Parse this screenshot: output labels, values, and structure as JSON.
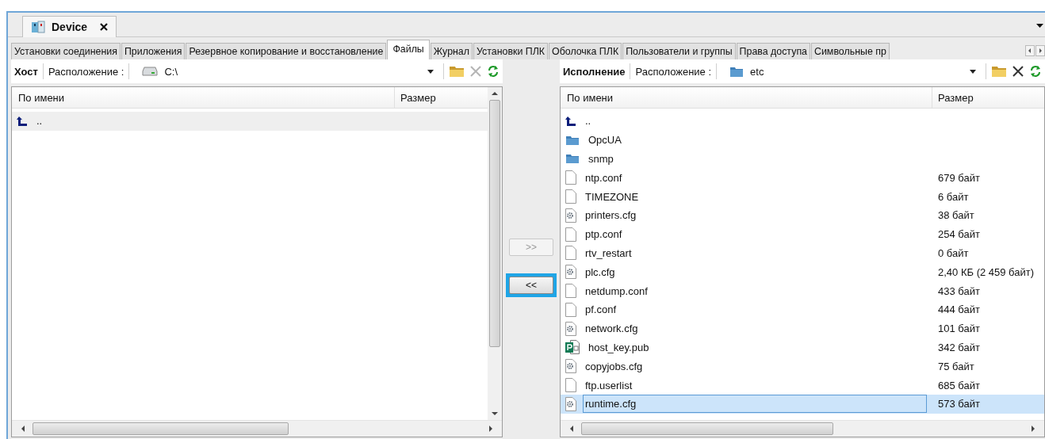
{
  "document_tab": {
    "title": "Device"
  },
  "tabs": [
    {
      "label": "Установки соединения",
      "selected": false
    },
    {
      "label": "Приложения",
      "selected": false
    },
    {
      "label": "Резервное копирование и восстановление",
      "selected": false
    },
    {
      "label": "Файлы",
      "selected": true
    },
    {
      "label": "Журнал",
      "selected": false
    },
    {
      "label": "Установки ПЛК",
      "selected": false
    },
    {
      "label": "Оболочка ПЛК",
      "selected": false
    },
    {
      "label": "Пользователи и группы",
      "selected": false
    },
    {
      "label": "Права доступа",
      "selected": false
    },
    {
      "label": "Символьные пр",
      "selected": false
    }
  ],
  "panels": [
    {
      "title": "Хост",
      "location_label": "Расположение :",
      "location": {
        "kind": "drive",
        "path": "C:\\"
      },
      "active": false,
      "delete_disabled": true,
      "vertical_scrollbar": true,
      "columns": [
        "По имени",
        "Размер"
      ],
      "rows": [
        {
          "kind": "up",
          "name": "..",
          "selected": true
        }
      ]
    },
    {
      "title": "Исполнение",
      "location_label": "Расположение :",
      "location": {
        "kind": "folder",
        "path": "etc"
      },
      "active": true,
      "delete_disabled": false,
      "vertical_scrollbar": false,
      "columns": [
        "По имени",
        "Размер"
      ],
      "rows": [
        {
          "kind": "up",
          "name": "..",
          "selected": false
        },
        {
          "kind": "folder",
          "name": "OpcUA",
          "selected": false
        },
        {
          "kind": "folder",
          "name": "snmp",
          "selected": false
        },
        {
          "kind": "file",
          "name": "ntp.conf",
          "size": "679 байт",
          "selected": false
        },
        {
          "kind": "file",
          "name": "TIMEZONE",
          "size": "6 байт",
          "selected": false
        },
        {
          "kind": "config",
          "name": "printers.cfg",
          "size": "38 байт",
          "selected": false
        },
        {
          "kind": "file",
          "name": "ptp.conf",
          "size": "254 байт",
          "selected": false
        },
        {
          "kind": "file",
          "name": "rtv_restart",
          "size": "0 байт",
          "selected": false
        },
        {
          "kind": "config",
          "name": "plc.cfg",
          "size": "2,40 КБ (2 459 байт)",
          "selected": false
        },
        {
          "kind": "file",
          "name": "netdump.conf",
          "size": "433 байт",
          "selected": false
        },
        {
          "kind": "file",
          "name": "pf.conf",
          "size": "444 байт",
          "selected": false
        },
        {
          "kind": "config",
          "name": "network.cfg",
          "size": "101 байт",
          "selected": false
        },
        {
          "kind": "publisher",
          "name": "host_key.pub",
          "size": "342 байт",
          "selected": false
        },
        {
          "kind": "config",
          "name": "copyjobs.cfg",
          "size": "75 байт",
          "selected": false
        },
        {
          "kind": "file",
          "name": "ftp.userlist",
          "size": "685 байт",
          "selected": false
        },
        {
          "kind": "config",
          "name": "runtime.cfg",
          "size": "573 байт",
          "selected": true
        }
      ]
    }
  ],
  "transfer_buttons": [
    {
      "label": ">>",
      "disabled": true,
      "focused": false
    },
    {
      "label": "<<",
      "disabled": false,
      "focused": true
    }
  ]
}
